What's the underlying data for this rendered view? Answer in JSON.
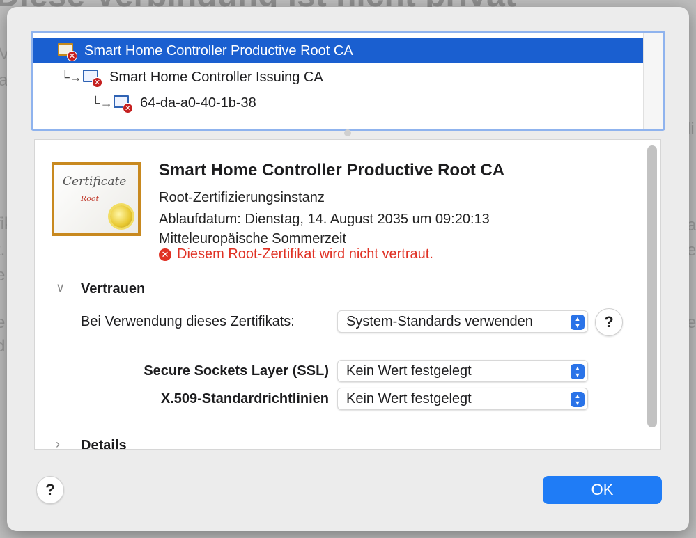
{
  "background": {
    "title_fragment": "Diese Verbindung ist nicht privat",
    "left_fragments": [
      "Ve",
      "a",
      "fik",
      "t.",
      "e",
      "e",
      "d"
    ],
    "right_fragments": [
      "li",
      "at",
      "e",
      "e"
    ]
  },
  "chain": {
    "items": [
      {
        "label": "Smart Home Controller Productive Root CA"
      },
      {
        "label": "Smart Home Controller Issuing CA"
      },
      {
        "label": "64-da-a0-40-1b-38"
      }
    ],
    "indent_glyph": "└",
    "arrow_glyph": "→"
  },
  "detail": {
    "cert_image": {
      "line1": "Certificate",
      "line2": "Root"
    },
    "title": "Smart Home Controller Productive Root CA",
    "type": "Root-Zertifizierungsinstanz",
    "expiry_line1": "Ablaufdatum: Dienstag, 14. August 2035 um 09:20:13",
    "expiry_line2": "Mitteleuropäische Sommerzeit",
    "warning": "Diesem Root-Zertifikat wird nicht vertraut.",
    "trust": {
      "section_label": "Vertrauen",
      "usage_label": "Bei Verwendung dieses Zertifikats:",
      "usage_value": "System-Standards verwenden",
      "ssl_label": "Secure Sockets Layer (SSL)",
      "ssl_value": "Kein Wert festgelegt",
      "x509_label": "X.509-Standardrichtlinien",
      "x509_value": "Kein Wert festgelegt",
      "help_label": "?"
    },
    "details_section_label": "Details"
  },
  "footer": {
    "help_label": "?",
    "ok_label": "OK"
  },
  "colors": {
    "selection": "#1a5fd0",
    "accent": "#1f7cf6",
    "error": "#e03124"
  }
}
